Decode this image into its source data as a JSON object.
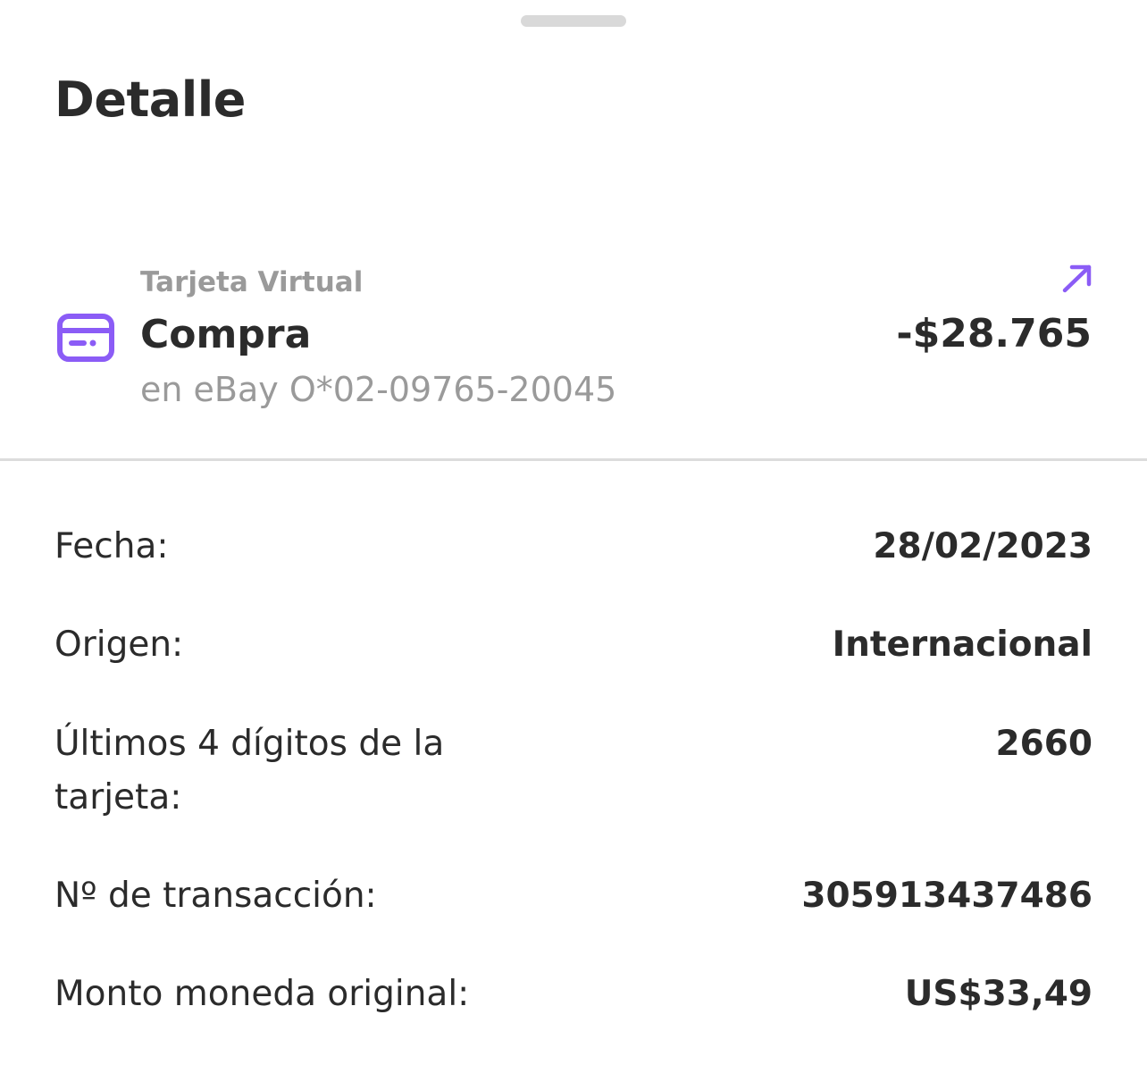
{
  "header": {
    "title": "Detalle"
  },
  "transaction": {
    "type_label": "Tarjeta Virtual",
    "name": "Compra",
    "merchant": "en eBay O*02-09765-20045",
    "amount": "-$28.765",
    "icon": "credit-card-icon",
    "direction_icon": "arrow-up-right-icon",
    "accent_color": "#8b5cf6"
  },
  "details": [
    {
      "label": "Fecha:",
      "value": "28/02/2023"
    },
    {
      "label": "Origen:",
      "value": "Internacional"
    },
    {
      "label": "Últimos 4 dígitos de la tarjeta:",
      "value": "2660"
    },
    {
      "label": "Nº de transacción:",
      "value": "305913437486"
    },
    {
      "label": "Monto moneda original:",
      "value": "US$33,49"
    }
  ]
}
